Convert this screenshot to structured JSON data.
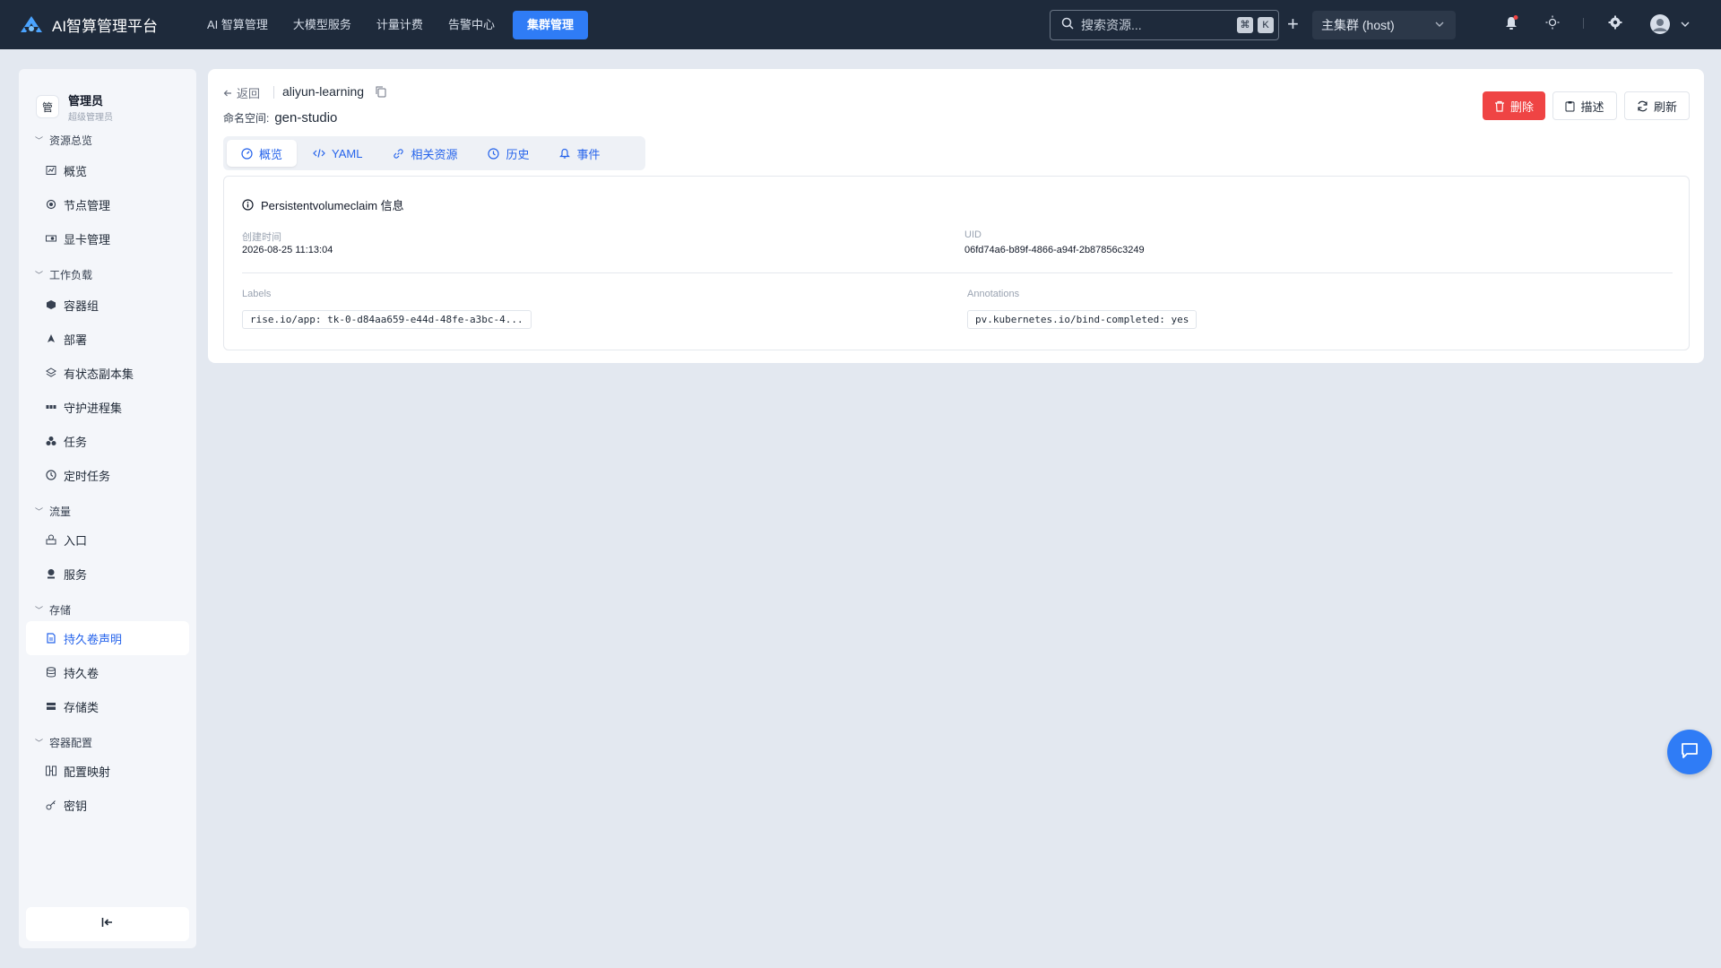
{
  "app": {
    "title": "AI智算管理平台"
  },
  "nav": [
    {
      "label": "AI 智算管理"
    },
    {
      "label": "大模型服务"
    },
    {
      "label": "计量计费"
    },
    {
      "label": "告警中心"
    },
    {
      "label": "集群管理"
    }
  ],
  "search": {
    "placeholder": "搜索资源...",
    "key1": "⌘",
    "key2": "K"
  },
  "cluster": {
    "selected": "主集群 (host)"
  },
  "user": {
    "avatar": "管",
    "name": "管理员",
    "role": "超级管理员"
  },
  "sidebar": {
    "groups": [
      {
        "title": "资源总览",
        "items": [
          {
            "label": "概览",
            "icon": "chart-icon"
          },
          {
            "label": "节点管理",
            "icon": "node-icon"
          },
          {
            "label": "显卡管理",
            "icon": "gpu-icon"
          }
        ]
      },
      {
        "title": "工作负载",
        "items": [
          {
            "label": "容器组",
            "icon": "pod-icon"
          },
          {
            "label": "部署",
            "icon": "deploy-icon"
          },
          {
            "label": "有状态副本集",
            "icon": "layers-icon"
          },
          {
            "label": "守护进程集",
            "icon": "daemon-icon"
          },
          {
            "label": "任务",
            "icon": "job-icon"
          },
          {
            "label": "定时任务",
            "icon": "clock-icon"
          }
        ]
      },
      {
        "title": "流量",
        "items": [
          {
            "label": "入口",
            "icon": "ingress-icon"
          },
          {
            "label": "服务",
            "icon": "service-icon"
          }
        ]
      },
      {
        "title": "存储",
        "items": [
          {
            "label": "持久卷声明",
            "icon": "pvc-icon"
          },
          {
            "label": "持久卷",
            "icon": "pv-icon"
          },
          {
            "label": "存储类",
            "icon": "storageclass-icon"
          }
        ]
      },
      {
        "title": "容器配置",
        "items": [
          {
            "label": "配置映射",
            "icon": "configmap-icon"
          },
          {
            "label": "密钥",
            "icon": "key-icon"
          }
        ]
      }
    ],
    "active": "持久卷声明"
  },
  "detail": {
    "back_label": "返回",
    "name": "aliyun-learning",
    "namespace_label": "命名空间:",
    "namespace": "gen-studio",
    "buttons": {
      "delete": "删除",
      "describe": "描述",
      "refresh": "刷新"
    },
    "tabs": [
      {
        "label": "概览"
      },
      {
        "label": "YAML"
      },
      {
        "label": "相关资源"
      },
      {
        "label": "历史"
      },
      {
        "label": "事件"
      }
    ],
    "info": {
      "title": "Persistentvolumeclaim 信息",
      "created_label": "创建时间",
      "created": "2026-08-25 11:13:04",
      "uid_label": "UID",
      "uid": "06fd74a6-b89f-4866-a94f-2b87856c3249",
      "labels_label": "Labels",
      "labels": [
        "rise.io/app: tk-0-d84aa659-e44d-48fe-a3bc-4..."
      ],
      "annotations_label": "Annotations",
      "annotations": [
        "pv.kubernetes.io/bind-completed: yes"
      ]
    }
  },
  "colors": {
    "topbar": "#1e2a3b",
    "accent": "#2f7cf6",
    "danger": "#ef4444",
    "background": "#e3e8f0"
  }
}
